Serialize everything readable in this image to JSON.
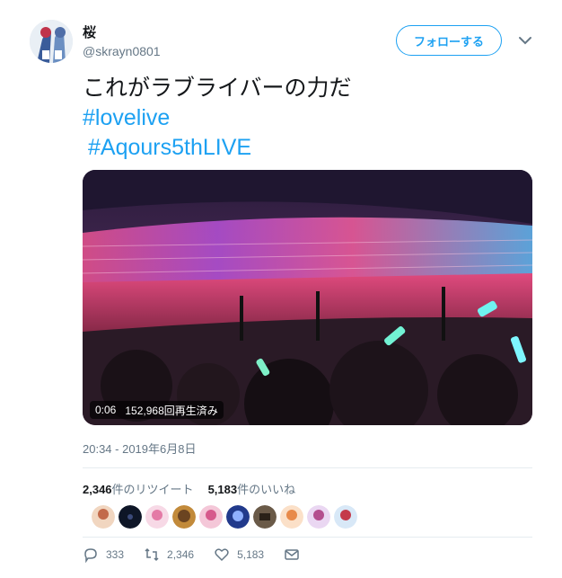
{
  "user": {
    "display_name": "桜",
    "handle": "@skrayn0801",
    "avatar_icon": "avatar-icon"
  },
  "follow_label": "フォローする",
  "tweet": {
    "text_line1": "これがラブライバーの力だ",
    "hashtag1": "#lovelive",
    "hashtag2": "#Aqours5thLIVE"
  },
  "media": {
    "duration": "0:06",
    "views": "152,968回再生済み"
  },
  "timestamp": "20:34 - 2019年6月8日",
  "stats": {
    "retweet_count": "2,346",
    "retweet_label": "件のリツイート",
    "like_count": "5,183",
    "like_label": "件のいいね"
  },
  "actions": {
    "reply_count": "333",
    "retweet_count": "2,346",
    "like_count": "5,183"
  },
  "colors": {
    "accent": "#1da1f2",
    "muted": "#657786",
    "text": "#14171a"
  }
}
